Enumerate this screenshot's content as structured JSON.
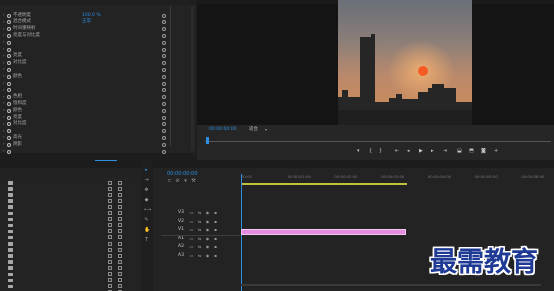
{
  "effects": {
    "rows": [
      {
        "label": "不透明度",
        "value": "100.0 %",
        "has_value": true
      },
      {
        "label": "混合模式",
        "value": "正常",
        "has_value": true
      },
      {
        "label": "时间重映射",
        "value": "",
        "has_value": false
      },
      {
        "label": "亮度与对比度",
        "value": "",
        "has_value": false
      },
      {
        "label": "",
        "value": "",
        "has_value": false
      },
      {
        "label": "",
        "value": "",
        "has_value": false
      },
      {
        "label": "亮度",
        "value": "",
        "has_value": false
      },
      {
        "label": "对比度",
        "value": "",
        "has_value": false
      },
      {
        "label": "",
        "value": "",
        "has_value": false
      },
      {
        "label": "颜色",
        "value": "",
        "has_value": false
      },
      {
        "label": "",
        "value": "",
        "has_value": false
      },
      {
        "label": "",
        "value": "",
        "has_value": false
      },
      {
        "label": "色相",
        "value": "",
        "has_value": false
      },
      {
        "label": "饱和度",
        "value": "",
        "has_value": false
      },
      {
        "label": "颜色",
        "value": "",
        "has_value": false
      },
      {
        "label": "亮度",
        "value": "",
        "has_value": false
      },
      {
        "label": "对比度",
        "value": "",
        "has_value": false
      },
      {
        "label": "",
        "value": "",
        "has_value": false
      },
      {
        "label": "高光",
        "value": "",
        "has_value": false
      },
      {
        "label": "阴影",
        "value": "",
        "has_value": false
      },
      {
        "label": "",
        "value": "",
        "has_value": false
      }
    ]
  },
  "program_monitor": {
    "timecode": "00:00:00:00",
    "fit_label": "适合",
    "transport_icons": [
      "marker-icon",
      "in-point-icon",
      "out-point-icon",
      "go-to-in-icon",
      "step-back-icon",
      "play-icon",
      "step-forward-icon",
      "go-to-out-icon",
      "lift-icon",
      "extract-icon",
      "export-frame-icon",
      "settings-icon"
    ]
  },
  "project_panel": {
    "tabs": [
      "",
      "",
      "",
      "",
      ""
    ],
    "items": [
      "",
      "",
      "",
      "",
      "",
      "",
      "",
      "",
      "",
      "",
      "",
      "",
      "",
      "",
      "",
      "",
      "",
      "",
      ""
    ]
  },
  "timeline": {
    "timecode": "00:00:00:00",
    "ruler": [
      "00:00",
      "00:00:01:00",
      "00:00:02:00",
      "00:00:03:00",
      "00:00:04:00",
      "00:00:05:00",
      "00:00:06:00"
    ],
    "clip_label": "",
    "tracks_video": [
      "V3",
      "V2",
      "V1"
    ],
    "tracks_audio": [
      "A1",
      "A2",
      "A3"
    ]
  },
  "watermark": {
    "text": "最需教育"
  },
  "colors": {
    "accent_blue": "#2e8fe0",
    "clip_pink": "#e28de0",
    "work_area": "#c2c23a",
    "panel_bg": "#232323",
    "watermark": "#1e3a95"
  }
}
